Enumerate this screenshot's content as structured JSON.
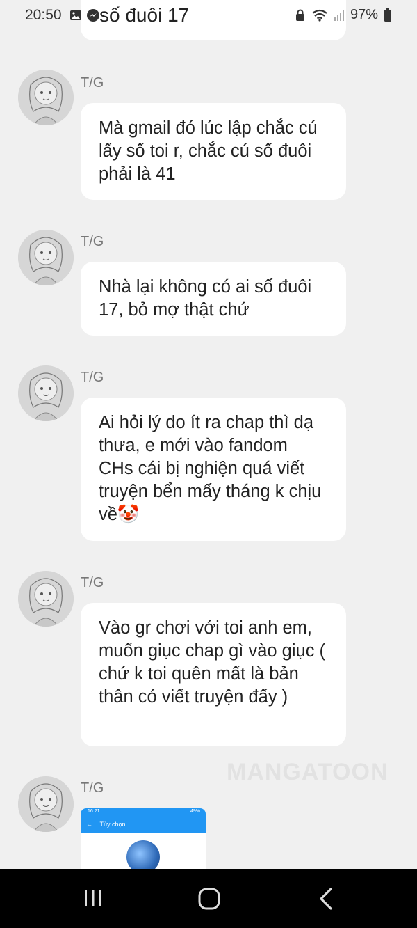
{
  "status_bar": {
    "time": "20:50",
    "battery": "97%"
  },
  "top_bubble_text": "số đuôi 17",
  "messages": [
    {
      "sender": "T/G",
      "text": "Mà gmail đó lúc lập chắc cú lấy số toi r, chắc cú số đuôi phải là 41"
    },
    {
      "sender": "T/G",
      "text": "Nhà lại không có ai số đuôi 17, bỏ mợ thật chứ"
    },
    {
      "sender": "T/G",
      "text": "Ai hỏi lý do ít ra chap thì dạ thưa, e mới vào fandom CHs cái bị nghiện quá viết truyện bển mấy tháng k chịu về🤡"
    },
    {
      "sender": "T/G",
      "text": "Vào gr chơi với toi anh em, muốn giục chap gì vào giục ( chứ k toi quên mất là bản thân có viết truyện đấy )"
    },
    {
      "sender": "T/G",
      "text": ""
    }
  ],
  "image_card": {
    "status_time": "16:21",
    "status_battery": "49%",
    "header": "Tùy chọn"
  },
  "watermark": "MANGATOON",
  "colors": {
    "background": "#f0f0f0",
    "bubble": "#ffffff",
    "accent_blue": "#2196f3",
    "nav_bar": "#000000"
  },
  "icons": [
    "image-icon",
    "messenger-icon",
    "lock-icon",
    "wifi-icon",
    "signal-icon",
    "battery-icon",
    "recents-icon",
    "home-icon",
    "back-icon"
  ]
}
